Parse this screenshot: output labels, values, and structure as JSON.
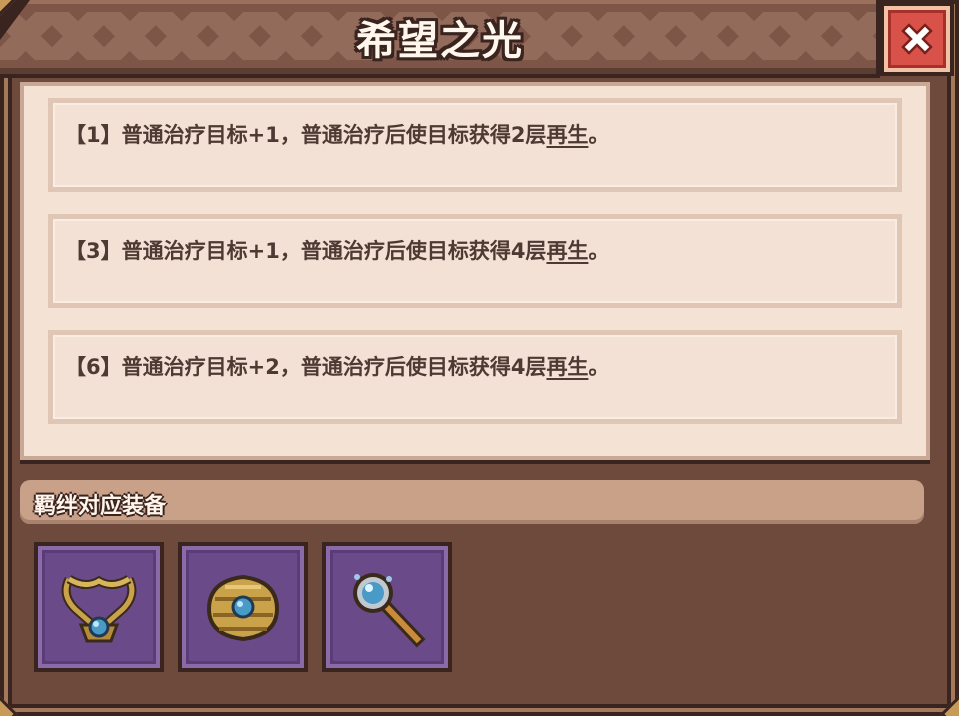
{
  "title": "希望之光",
  "close_icon": "close-icon",
  "effects": [
    {
      "prefix": "【1】普通治疗目标+1，普通治疗后使目标获得2层",
      "keyword": "再生",
      "suffix": "。"
    },
    {
      "prefix": "【3】普通治疗目标+1，普通治疗后使目标获得4层",
      "keyword": "再生",
      "suffix": "。"
    },
    {
      "prefix": "【6】普通治疗目标+2，普通治疗后使目标获得4层",
      "keyword": "再生",
      "suffix": "。"
    }
  ],
  "bond_section": {
    "header": "羁绊对应装备",
    "items": [
      {
        "icon": "amulet-icon"
      },
      {
        "icon": "shell-charm-icon"
      },
      {
        "icon": "magnifier-staff-icon"
      }
    ]
  },
  "colors": {
    "frame": "#6e4a3c",
    "panel": "#f4e2d4",
    "text": "#4f3a33",
    "close_red": "#d8524a",
    "slot_purple": "#6b4a8a"
  }
}
